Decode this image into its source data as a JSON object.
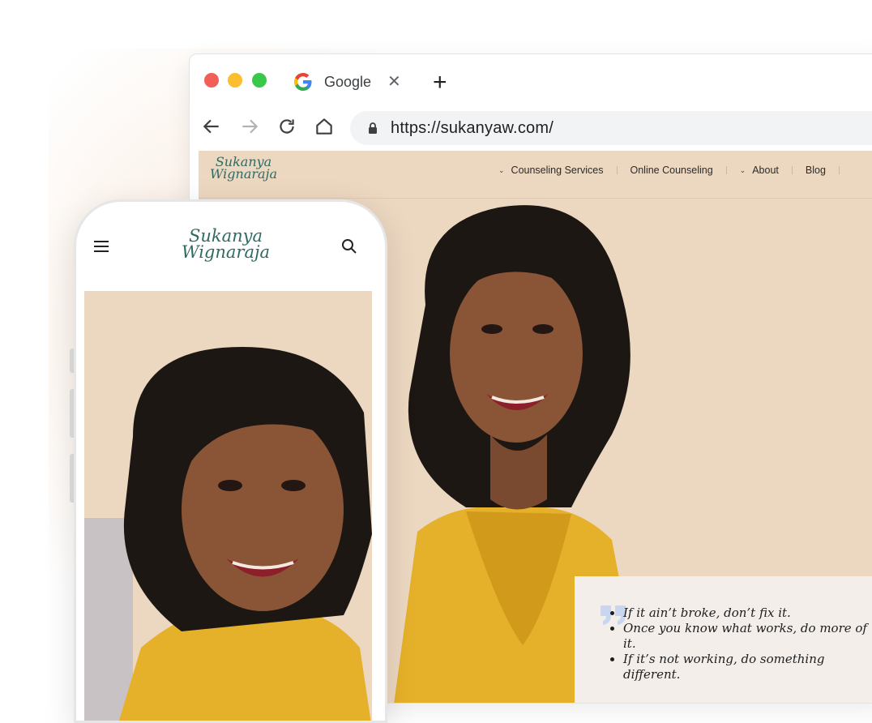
{
  "browser": {
    "tab": {
      "title": "Google",
      "close_icon": "close-icon"
    },
    "new_tab_icon": "plus-icon",
    "address": {
      "url": "https://sukanyaw.com/"
    },
    "traffic_lights": {
      "red": "#f25f58",
      "yellow": "#fbbe2e",
      "green": "#39c84a"
    }
  },
  "site": {
    "brand": {
      "line1": "Sukanya",
      "line2": "Wignaraja"
    },
    "menu": [
      {
        "label": "Counseling Services",
        "has_dropdown": true
      },
      {
        "label": "Online Counseling",
        "has_dropdown": false
      },
      {
        "label": "About",
        "has_dropdown": true
      },
      {
        "label": "Blog",
        "has_dropdown": false
      }
    ],
    "quote": {
      "lines": [
        "If it ain’t broke, don’t fix it.",
        "Once you know what works, do more of it.",
        "If it’s not working, do something different."
      ]
    },
    "colors": {
      "background": "#ecd7c1",
      "brand": "#2f6b63",
      "quote_box": "#f3eeea",
      "dress": "#e6b12a"
    }
  },
  "phone": {
    "brand": {
      "line1": "Sukanya",
      "line2": "Wignaraja"
    },
    "menu_icon": "hamburger-icon",
    "search_icon": "search-icon"
  }
}
